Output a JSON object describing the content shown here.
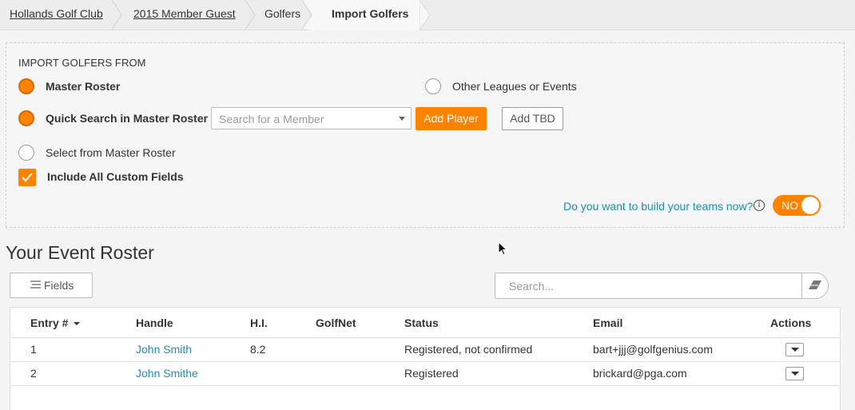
{
  "breadcrumb": {
    "items": [
      {
        "label": "Hollands Golf Club"
      },
      {
        "label": "2015 Member Guest"
      },
      {
        "label": "Golfers"
      },
      {
        "label": "Import Golfers"
      }
    ]
  },
  "import": {
    "title": "IMPORT GOLFERS FROM",
    "options": {
      "master_roster": "Master Roster",
      "other_leagues": "Other Leagues or Events",
      "quick_search": "Quick Search in Master Roster",
      "select_from": "Select from Master Roster"
    },
    "search_placeholder": "Search for a Member",
    "add_player": "Add Player",
    "add_tbd": "Add TBD",
    "include_custom": "Include All Custom Fields",
    "build_teams_question": "Do you want to build your teams now?",
    "info_glyph": "i",
    "toggle_label": "NO"
  },
  "roster": {
    "title": "Your Event Roster",
    "fields_button": "Fields",
    "search_placeholder": "Search...",
    "columns": [
      "Entry #",
      "Handle",
      "H.I.",
      "GolfNet",
      "Status",
      "Email",
      "Actions"
    ],
    "rows": [
      {
        "entry": "1",
        "handle": "John Smith",
        "hi": "8.2",
        "golfnet": "",
        "status": "Registered, not confirmed",
        "email": "bart+jjj@golfgenius.com"
      },
      {
        "entry": "2",
        "handle": "John Smithe",
        "hi": "",
        "golfnet": "",
        "status": "Registered",
        "email": "brickard@pga.com"
      }
    ]
  },
  "colors": {
    "accent": "#ff8200",
    "link": "#1d8fb0"
  }
}
